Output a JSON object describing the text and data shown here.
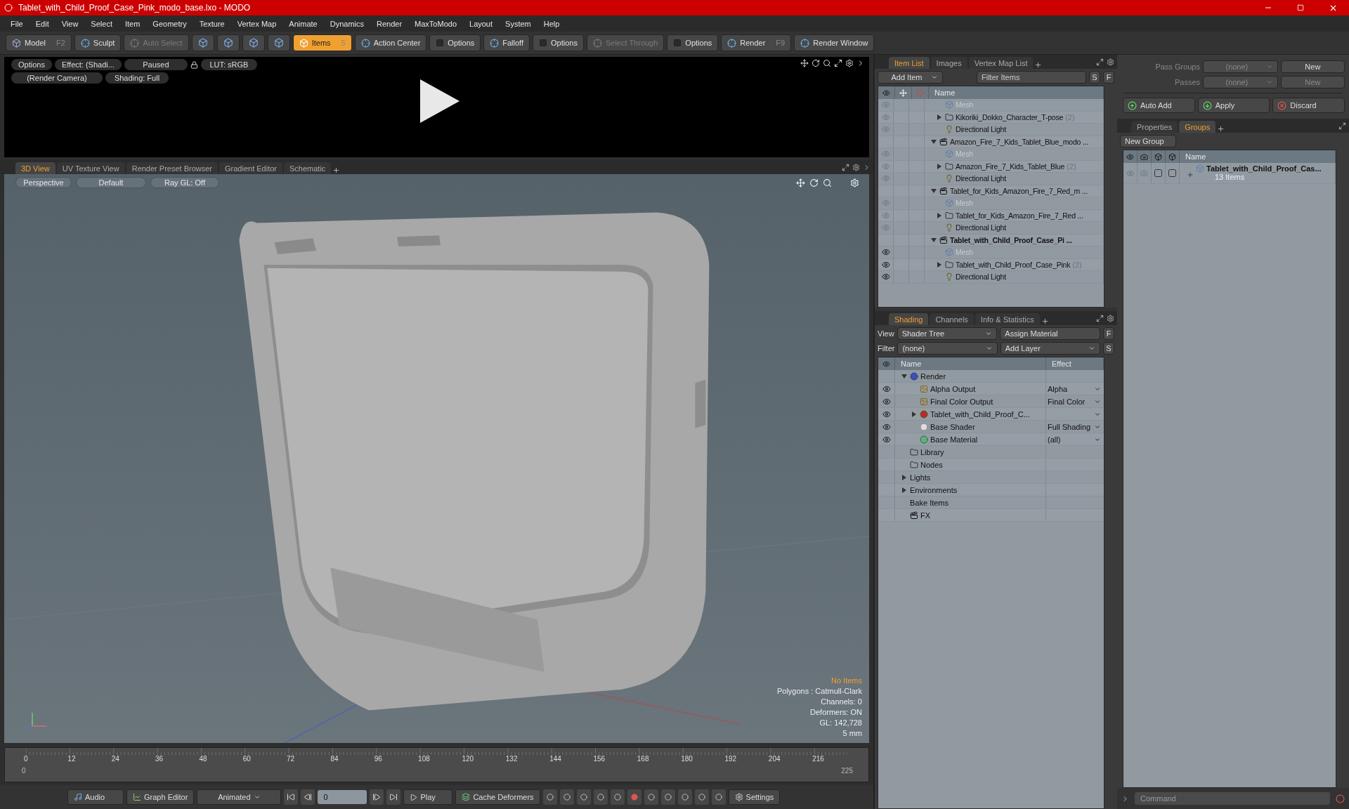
{
  "window": {
    "title": "Tablet_with_Child_Proof_Case_Pink_modo_base.lxo - MODO"
  },
  "menu": [
    "File",
    "Edit",
    "View",
    "Select",
    "Item",
    "Geometry",
    "Texture",
    "Vertex Map",
    "Animate",
    "Dynamics",
    "Render",
    "MaxToModo",
    "Layout",
    "System",
    "Help"
  ],
  "toolbar": [
    {
      "kind": "mode",
      "label": "Model",
      "shortcut": "F2",
      "selected": false,
      "disabled": false
    },
    {
      "kind": "tool",
      "label": "Sculpt",
      "selected": false,
      "disabled": false
    },
    {
      "kind": "tool",
      "label": "Auto Select",
      "selected": false,
      "disabled": true
    },
    {
      "kind": "icon",
      "selected": false
    },
    {
      "kind": "icon",
      "selected": false
    },
    {
      "kind": "icon",
      "selected": false
    },
    {
      "kind": "icon",
      "selected": false
    },
    {
      "kind": "mode",
      "label": "Items",
      "shortcut": "5",
      "selected": true,
      "disabled": false
    },
    {
      "kind": "tool",
      "label": "Action Center",
      "selected": false,
      "disabled": false
    },
    {
      "kind": "option",
      "label": "Options",
      "selected": false,
      "disabled": false
    },
    {
      "kind": "tool",
      "label": "Falloff",
      "selected": false,
      "disabled": false
    },
    {
      "kind": "option",
      "label": "Options",
      "selected": false,
      "disabled": false
    },
    {
      "kind": "tool",
      "label": "Select Through",
      "selected": false,
      "disabled": true
    },
    {
      "kind": "option",
      "label": "Options",
      "selected": false,
      "disabled": false
    },
    {
      "kind": "tool",
      "label": "Render",
      "shortcut": "F9",
      "selected": false,
      "disabled": false
    },
    {
      "kind": "tool",
      "label": "Render Window",
      "selected": false,
      "disabled": false
    }
  ],
  "render_preview": {
    "row_1": [
      "Options",
      "Effect: (Shadi...",
      "Paused",
      "LUT: sRGB"
    ],
    "row_2": [
      "(Render Camera)",
      "Shading: Full"
    ]
  },
  "viewport": {
    "tabs": [
      {
        "label": "3D View",
        "selected": true
      },
      {
        "label": "UV Texture View",
        "selected": false
      },
      {
        "label": "Render Preset Browser",
        "selected": false
      },
      {
        "label": "Gradient Editor",
        "selected": false
      },
      {
        "label": "Schematic",
        "selected": false
      }
    ],
    "controls": [
      "Perspective",
      "Default",
      "Ray GL: Off"
    ],
    "info": [
      {
        "text": "No Items",
        "highlight": true
      },
      {
        "text": "Polygons : Catmull-Clark",
        "highlight": false
      },
      {
        "text": "Channels: 0",
        "highlight": false
      },
      {
        "text": "Deformers: ON",
        "highlight": false
      },
      {
        "text": "GL: 142,728",
        "highlight": false
      },
      {
        "text": "5 mm",
        "highlight": false
      }
    ]
  },
  "timeline": {
    "ticks": [
      "0",
      "12",
      "24",
      "36",
      "48",
      "60",
      "72",
      "84",
      "96",
      "108",
      "120",
      "132",
      "144",
      "156",
      "168",
      "180",
      "192",
      "204",
      "216"
    ],
    "start": "0",
    "end": "225"
  },
  "bottom_bar": {
    "audio": "Audio",
    "graph_editor": "Graph Editor",
    "mode": "Animated",
    "frame": "0",
    "play": "Play",
    "cache": "Cache Deformers",
    "settings": "Settings"
  },
  "item_list": {
    "tabs": [
      {
        "label": "Item List",
        "selected": true
      },
      {
        "label": "Images",
        "selected": false
      },
      {
        "label": "Vertex Map List",
        "selected": false
      }
    ],
    "add_item": "Add Item",
    "filter": {
      "placeholder": "Filter Items"
    },
    "buttons": [
      "S",
      "F"
    ],
    "column": "Name",
    "rows": [
      {
        "kind": "mesh",
        "label": "Mesh",
        "active": false
      },
      {
        "kind": "folder",
        "label": "Kikoriki_Dokko_Character_T-pose",
        "count": "(2)",
        "active": false,
        "expanded": false
      },
      {
        "kind": "light",
        "label": "Directional Light",
        "active": false
      },
      {
        "kind": "scene",
        "label": "Amazon_Fire_7_Kids_Tablet_Blue_modo ...",
        "expanded": true,
        "bold": false,
        "children": [
          {
            "kind": "mesh",
            "label": "Mesh",
            "active": false
          },
          {
            "kind": "folder",
            "label": "Amazon_Fire_7_Kids_Tablet_Blue",
            "count": "(2)",
            "active": false,
            "expanded": false
          },
          {
            "kind": "light",
            "label": "Directional Light",
            "active": false
          }
        ]
      },
      {
        "kind": "scene",
        "label": "Tablet_for_Kids_Amazon_Fire_7_Red_m ...",
        "expanded": true,
        "bold": false,
        "children": [
          {
            "kind": "mesh",
            "label": "Mesh",
            "active": false
          },
          {
            "kind": "folder",
            "label": "Tablet_for_Kids_Amazon_Fire_7_Red ...",
            "active": false,
            "expanded": false
          },
          {
            "kind": "light",
            "label": "Directional Light",
            "active": false
          }
        ]
      },
      {
        "kind": "scene",
        "label": "Tablet_with_Child_Proof_Case_Pi ...",
        "expanded": true,
        "bold": true,
        "children": [
          {
            "kind": "mesh",
            "label": "Mesh",
            "active": true
          },
          {
            "kind": "folder",
            "label": "Tablet_with_Child_Proof_Case_Pink",
            "count": "(2)",
            "active": true,
            "expanded": false
          },
          {
            "kind": "light",
            "label": "Directional Light",
            "active": true
          }
        ]
      }
    ]
  },
  "shading": {
    "tabs": [
      {
        "label": "Shading",
        "selected": true
      },
      {
        "label": "Channels",
        "selected": false
      },
      {
        "label": "Info & Statistics",
        "selected": false
      }
    ],
    "view_label": "View",
    "view": "Shader Tree",
    "assign": "Assign Material",
    "f": "F",
    "filter_label": "Filter",
    "filter": "(none)",
    "add_layer": "Add Layer",
    "s": "S",
    "columns": [
      "Name",
      "Effect"
    ],
    "rows": [
      {
        "kind": "render",
        "label": "Render",
        "expanded": true,
        "children": [
          {
            "kind": "output",
            "label": "Alpha Output",
            "effect": "Alpha"
          },
          {
            "kind": "output",
            "label": "Final Color Output",
            "effect": "Final Color"
          },
          {
            "kind": "material_group",
            "label": "Tablet_with_Child_Proof_C...",
            "expanded": false
          },
          {
            "kind": "shader",
            "label": "Base Shader",
            "effect": "Full Shading"
          },
          {
            "kind": "material",
            "label": "Base Material",
            "effect": "(all)"
          }
        ]
      },
      {
        "kind": "folder",
        "label": "Library"
      },
      {
        "kind": "folder",
        "label": "Nodes"
      },
      {
        "kind": "group",
        "label": "Lights",
        "expanded": false
      },
      {
        "kind": "group",
        "label": "Environments",
        "expanded": false
      },
      {
        "kind": "plain",
        "label": "Bake Items"
      },
      {
        "kind": "fx",
        "label": "FX"
      }
    ]
  },
  "passes": {
    "rows": [
      {
        "label": "Pass Groups",
        "value": "(none)",
        "button": "New",
        "disabled": false
      },
      {
        "label": "Passes",
        "value": "(none)",
        "button": "New",
        "disabled": true
      }
    ],
    "actions": [
      "Auto Add",
      "Apply",
      "Discard"
    ]
  },
  "groups": {
    "tabs": [
      {
        "label": "Properties",
        "selected": false
      },
      {
        "label": "Groups",
        "selected": true
      }
    ],
    "new_group": "New Group",
    "column": "Name",
    "rows": [
      {
        "label": "Tablet_with_Child_Proof_Cas...",
        "count": "13 Items",
        "selectable": false,
        "locked": false
      }
    ]
  },
  "command": {
    "placeholder": "Command"
  }
}
